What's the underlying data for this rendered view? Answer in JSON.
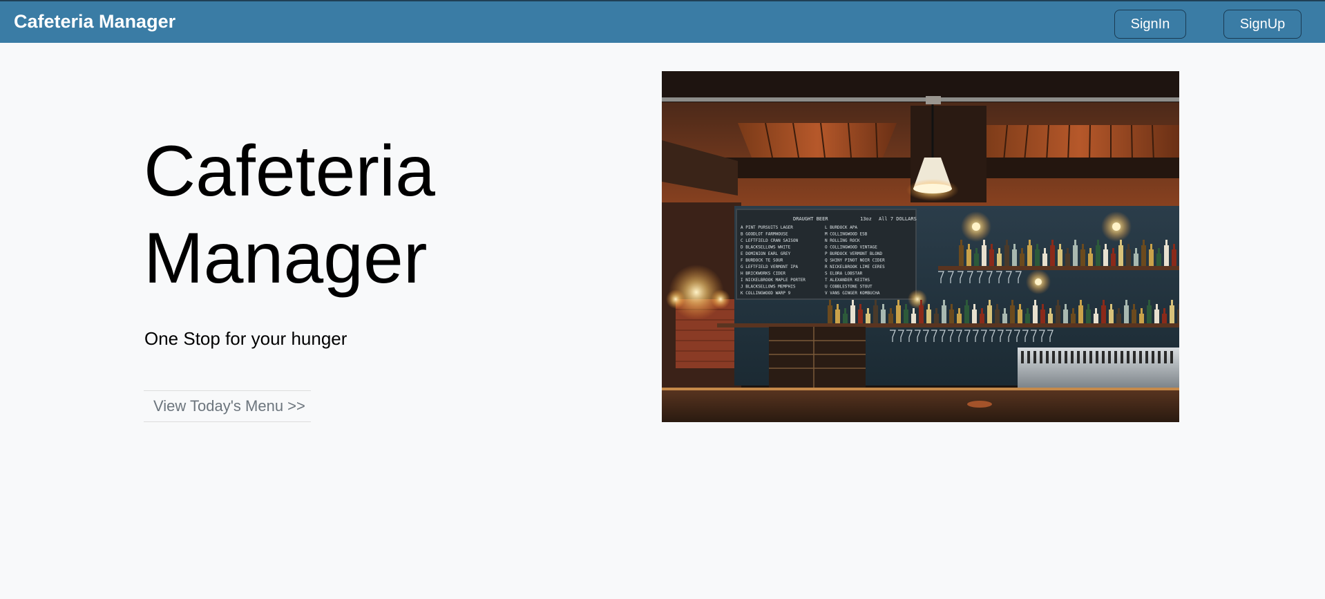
{
  "navbar": {
    "brand": "Cafeteria Manager",
    "signin_label": "SignIn",
    "signup_label": "SignUp",
    "color": "#3a7ca5"
  },
  "hero": {
    "title_line1": "Cafeteria",
    "title_line2": "Manager",
    "tagline": "One Stop for your hunger",
    "menu_link": "View Today's Menu >>"
  },
  "image": {
    "subject": "bar-interior-photo",
    "board_heading": "DRAUGHT BEER",
    "board_size": "13oz",
    "board_price": "All 7 DOLLARS",
    "board_left": [
      "A PINT PURSUITS LAGER",
      "B GOODLOT FARMHOUSE",
      "C LEFTFIELD CRAN SAISON",
      "D BLACKSELLOWS WHITE",
      "E DOMINION EARL GREY",
      "F BURDOCK TE SOUR",
      "G LEFTFIELD VERMONT IPA",
      "H BRICKWORKS CIDER",
      "I NICKELBROOK MAPLE PORTER",
      "J BLACKSELLOWS MEMPHIS",
      "K COLLINGWOOD WARP 9"
    ],
    "board_right": [
      "L BURDOCK APA",
      "M COLLINGWOOD ESB",
      "N ROLLING ROCK",
      "O COLLINGWOOD VINTAGE",
      "P BURDOCK VERMONT BLOND",
      "Q SHINY PINOT NOIR CIDER",
      "R NICKELBROOK LIME CERES",
      "S ELORA LOBSTAR",
      "T ALEXANDER KEITHS",
      "U COBBLESTONE STOUT",
      "V VANS GINGER KOMBUCHA"
    ]
  }
}
